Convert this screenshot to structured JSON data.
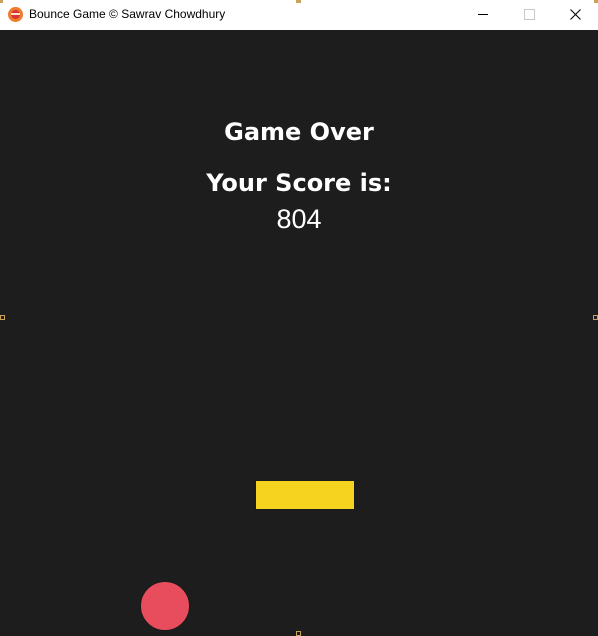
{
  "window": {
    "title": "Bounce Game © Sawrav Chowdhury",
    "icon": "bounce-app-icon"
  },
  "controls": {
    "minimize_icon": "minimize-icon",
    "maximize_icon": "maximize-icon",
    "close_icon": "close-icon"
  },
  "game": {
    "game_over_text": "Game Over",
    "score_label": "Your Score is:",
    "score_value": "804",
    "colors": {
      "background": "#1e1d1d",
      "paddle": "#f5d31f",
      "ball": "#e84d5d",
      "text": "#ffffff"
    }
  }
}
